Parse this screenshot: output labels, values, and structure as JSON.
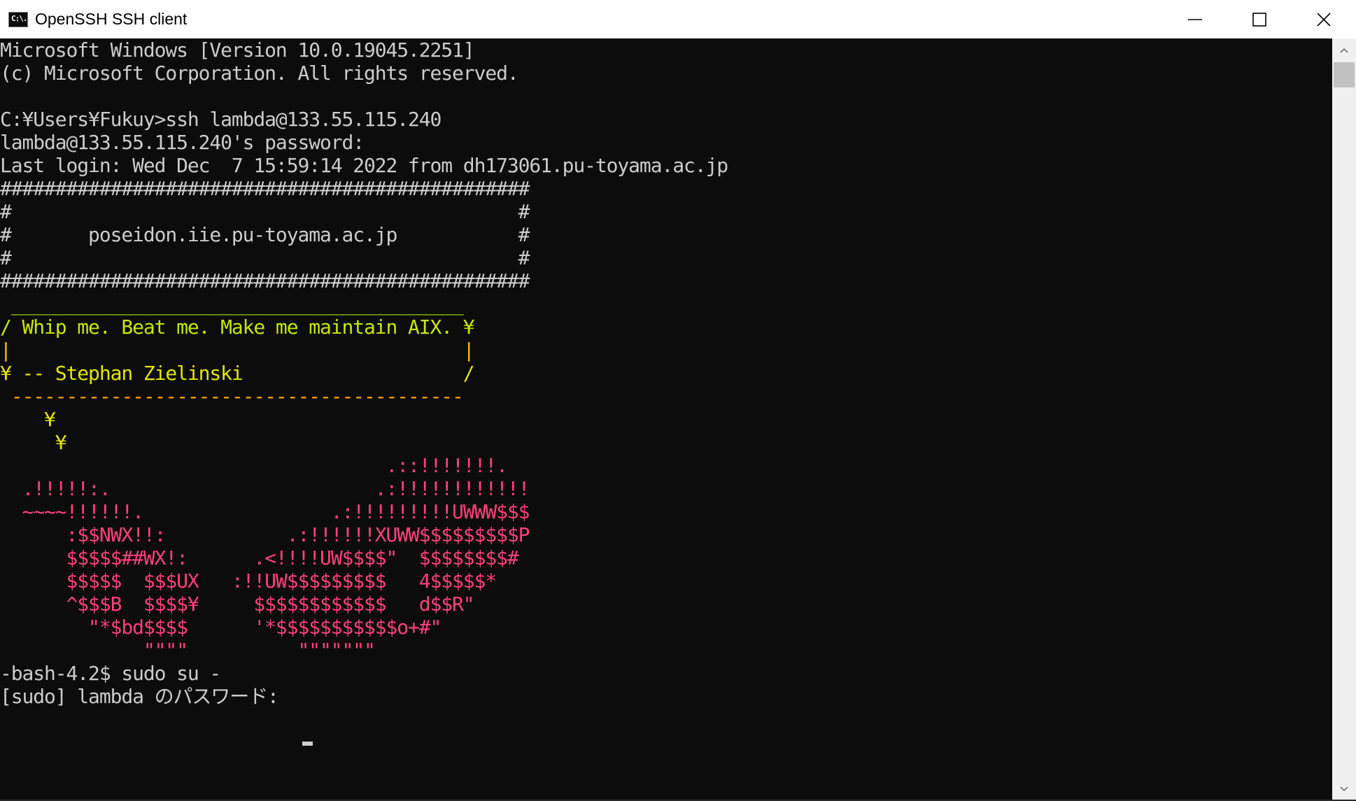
{
  "window": {
    "title": "OpenSSH SSH client",
    "icon": "console-app-icon",
    "icon_text": "C:\\.",
    "controls": [
      "minimize",
      "maximize",
      "close"
    ]
  },
  "colors": {
    "default_text": "#cccccc",
    "background": "#0c0c0c",
    "rainbow": [
      "#e5e500",
      "#ffa200",
      "#ff7f00",
      "#ff3f7f",
      "#ff0080"
    ]
  },
  "terminal": {
    "lines": [
      {
        "text": "Microsoft Windows [Version 10.0.19045.2251]",
        "color": "#cccccc"
      },
      {
        "text": "(c) Microsoft Corporation. All rights reserved.",
        "color": "#cccccc"
      },
      {
        "text": "",
        "color": "#cccccc"
      },
      {
        "text": "C:¥Users¥Fukuy>ssh lambda@133.55.115.240",
        "color": "#cccccc"
      },
      {
        "text": "lambda@133.55.115.240's password:",
        "color": "#cccccc"
      },
      {
        "text": "Last login: Wed Dec  7 15:59:14 2022 from dh173061.pu-toyama.ac.jp",
        "color": "#cccccc"
      },
      {
        "text": "################################################",
        "color": "#cccccc"
      },
      {
        "text": "#                                              #",
        "color": "#cccccc"
      },
      {
        "text": "#       poseidon.iie.pu-toyama.ac.jp           #",
        "color": "#cccccc"
      },
      {
        "text": "#                                              #",
        "color": "#cccccc"
      },
      {
        "text": "################################################",
        "color": "#cccccc"
      },
      {
        "text": " _________________________________________",
        "color": "#a8e000"
      },
      {
        "text": "/ Whip me. Beat me. Make me maintain AIX. ¥",
        "color": "#c8e600"
      },
      {
        "text": "|                                         |",
        "color": "#f2c000"
      },
      {
        "text": "¥ -- Stephan Zielinski                    /",
        "color": "#e5e500"
      },
      {
        "text": " -----------------------------------------",
        "color": "#ffa500"
      },
      {
        "text": "    ¥",
        "color": "#e5e500"
      },
      {
        "text": "     ¥",
        "color": "#e5e500"
      },
      {
        "text": "                                   .::!!!!!!!.",
        "color": "#ff3f7f"
      },
      {
        "text": "  .!!!!!:.                        .:!!!!!!!!!!!!",
        "color": "#ff3f7f"
      },
      {
        "text": "  ~~~~!!!!!!.                 .:!!!!!!!!!UWWW$$$",
        "color": "#ff3f7f"
      },
      {
        "text": "      :$$NWX!!:           .:!!!!!!XUWW$$$$$$$$$P",
        "color": "#ff3f7f"
      },
      {
        "text": "      $$$$$##WX!:      .<!!!!UW$$$$\"  $$$$$$$$#",
        "color": "#ff3f7f"
      },
      {
        "text": "      $$$$$  $$$UX   :!!UW$$$$$$$$$   4$$$$$*",
        "color": "#ff3f7f"
      },
      {
        "text": "      ^$$$B  $$$$¥     $$$$$$$$$$$$   d$$R\"",
        "color": "#ff3f7f"
      },
      {
        "text": "        \"*$bd$$$$      '*$$$$$$$$$$$o+#\"",
        "color": "#ff3f7f"
      },
      {
        "text": "             \"\"\"\"          \"\"\"\"\"\"\"",
        "color": "#ff3f7f"
      },
      {
        "text": "-bash-4.2$ sudo su -",
        "color": "#cccccc"
      },
      {
        "text": "[sudo] lambda のパスワード:",
        "color": "#cccccc"
      }
    ]
  }
}
